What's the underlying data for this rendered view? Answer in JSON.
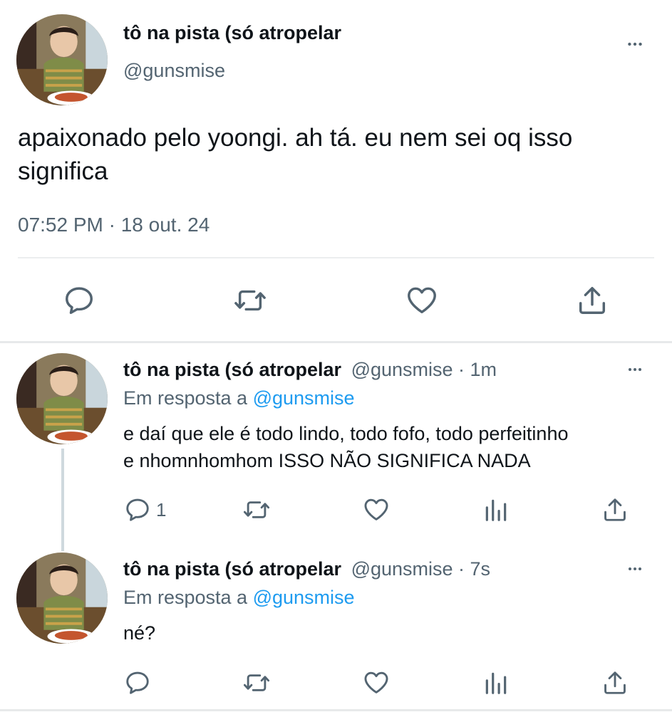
{
  "main_tweet": {
    "name": "tô na pista (só atropelar",
    "handle": "@gunsmise",
    "text": "apaixonado pelo yoongi. ah tá. eu nem sei oq isso significa",
    "timestamp": "07:52 PM · 18 out. 24"
  },
  "replies": [
    {
      "name": "tô na pista (só atropelar",
      "handle_time": "@gunsmise · 1m",
      "reply_prefix": "Em resposta a",
      "reply_to": "@gunsmise",
      "text_line1": "e daí que ele é todo lindo, todo fofo, todo perfeitinho",
      "text_line2": "e nhomnhomhom ISSO NÃO SIGNIFICA NADA",
      "reply_count": "1"
    },
    {
      "name": "tô na pista (só atropelar",
      "handle_time": "@gunsmise · 7s",
      "reply_prefix": "Em resposta a",
      "reply_to": "@gunsmise",
      "text_line1": "né?",
      "reply_count": ""
    }
  ],
  "icons": [
    "more-icon",
    "reply-icon",
    "retweet-icon",
    "like-icon",
    "analytics-icon",
    "share-icon"
  ],
  "colors": {
    "text": "#0f1419",
    "muted": "#536471",
    "link": "#1d9bf0",
    "divider": "#e7e9ea"
  }
}
